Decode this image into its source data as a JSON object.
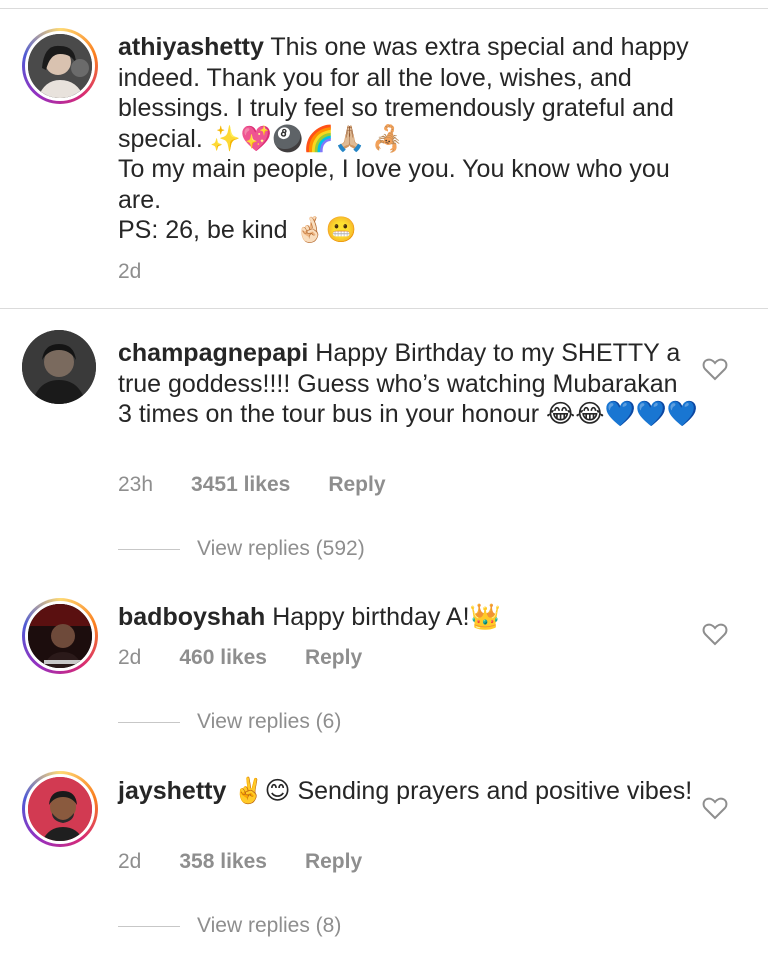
{
  "caption": {
    "username": "athiyashetty",
    "text": " This one was extra special and happy indeed. Thank you for all the love, wishes, and blessings. I truly feel so tremendously grateful and special. ✨💖🎱🌈🙏🏼 🦂\nTo my main people, I love you. You know who you are.\nPS: 26, be kind 🤞🏻😬",
    "time": "2d",
    "avatar_icon": "profile-photo"
  },
  "comments": [
    {
      "username": "champagnepapi",
      "text": " Happy Birthday to my SHETTY a true goddess!!!! Guess who’s watching Mubarakan 3 times on the tour bus in your honour 😂😂💙💙💙",
      "time": "23h",
      "likes": "3451 likes",
      "reply": "Reply",
      "view_replies": "View replies (592)",
      "heart_icon": "heart-outline-icon"
    },
    {
      "username": "badboyshah",
      "text": " Happy birthday A!👑",
      "time": "2d",
      "likes": "460 likes",
      "reply": "Reply",
      "view_replies": "View replies (6)",
      "heart_icon": "heart-outline-icon"
    },
    {
      "username": "jayshetty",
      "text": " ✌️😊 Sending prayers and positive vibes!",
      "time": "2d",
      "likes": "358 likes",
      "reply": "Reply",
      "view_replies": "View replies (8)",
      "heart_icon": "heart-outline-icon"
    }
  ],
  "colors": {
    "text": "#262626",
    "secondary": "#8e8e8e",
    "divider": "#dbdbdb"
  }
}
